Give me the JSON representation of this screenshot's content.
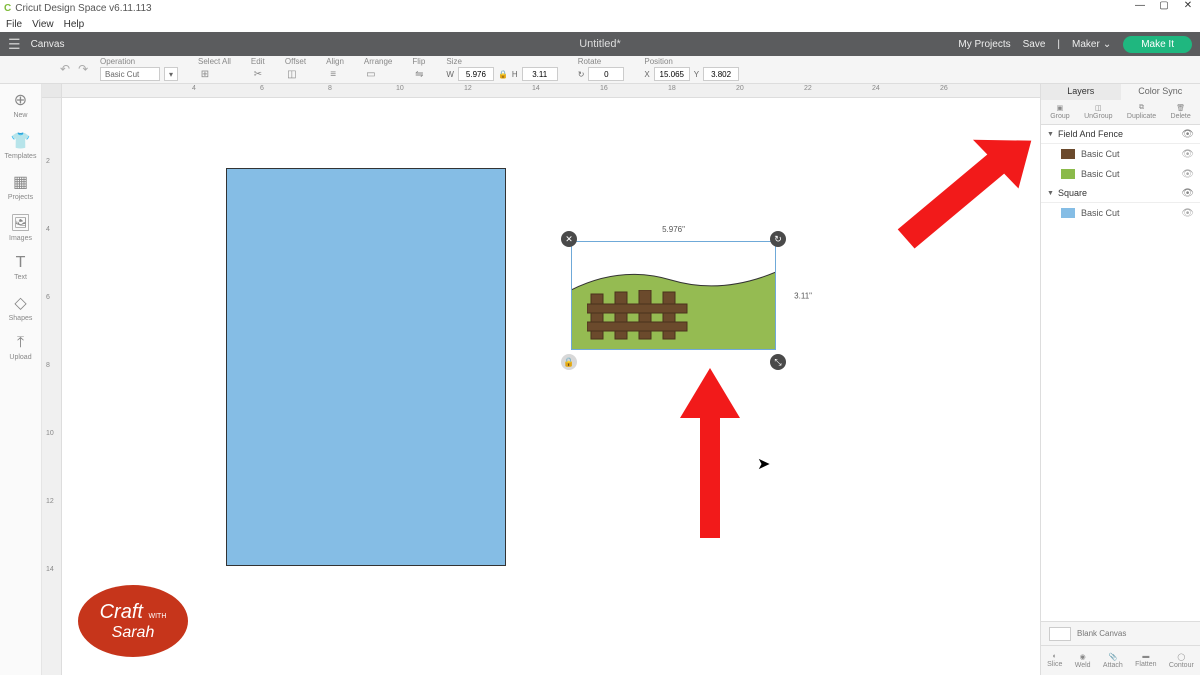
{
  "titlebar": {
    "app_name": "Cricut Design Space v6.11.113"
  },
  "menubar": {
    "file": "File",
    "view": "View",
    "help": "Help"
  },
  "appbar": {
    "canvas": "Canvas",
    "doc_title": "Untitled*",
    "my_projects": "My Projects",
    "save": "Save",
    "maker": "Maker",
    "make_it": "Make It"
  },
  "toolbar": {
    "operation_lbl": "Operation",
    "operation_val": "Basic Cut",
    "select_all": "Select All",
    "edit": "Edit",
    "offset": "Offset",
    "align": "Align",
    "arrange": "Arrange",
    "flip": "Flip",
    "size_lbl": "Size",
    "w": "W",
    "w_val": "5.976",
    "h": "H",
    "h_val": "3.11",
    "rotate_lbl": "Rotate",
    "rotate_val": "0",
    "position_lbl": "Position",
    "x": "X",
    "x_val": "15.065",
    "y": "Y",
    "y_val": "3.802"
  },
  "lefttools": {
    "new": "New",
    "templates": "Templates",
    "projects": "Projects",
    "images": "Images",
    "text": "Text",
    "shapes": "Shapes",
    "upload": "Upload"
  },
  "selection": {
    "w_label": "5.976\"",
    "h_label": "3.11\""
  },
  "layerspanel": {
    "tab_layers": "Layers",
    "tab_color": "Color Sync",
    "group": "Group",
    "ungroup": "UnGroup",
    "duplicate": "Duplicate",
    "delete": "Delete",
    "g1": "Field And Fence",
    "g1_a": "Basic Cut",
    "g1_b": "Basic Cut",
    "g2": "Square",
    "g2_a": "Basic Cut",
    "blank": "Blank Canvas",
    "slice": "Slice",
    "weld": "Weld",
    "attach": "Attach",
    "flatten": "Flatten",
    "contour": "Contour"
  },
  "ruler_h": [
    "4",
    "6",
    "8",
    "10",
    "12",
    "14",
    "16",
    "18",
    "20",
    "22",
    "24",
    "26"
  ],
  "ruler_v": [
    "2",
    "4",
    "6",
    "8",
    "10",
    "12",
    "14"
  ],
  "badge": {
    "l1": "Craft",
    "with": "WITH",
    "l2": "Sarah"
  }
}
